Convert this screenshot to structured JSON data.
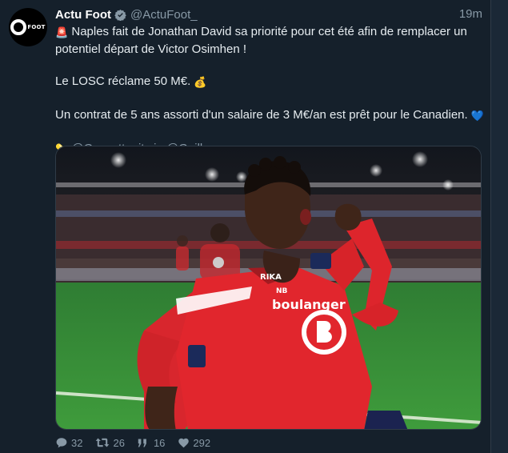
{
  "tweet": {
    "display_name": "Actu Foot",
    "handle": "@ActuFoot_",
    "time": "19m",
    "avatar_text": "FOOT",
    "lines": [
      "Naples fait de Jonathan David sa priorité pour cet été afin de remplacer un",
      "potentiel départ de Victor Osimhen !",
      "Le LOSC réclame 50 M€.",
      "Un contrat de 5 ans assorti d'un salaire de 3 M€/an est prêt pour le Canadien."
    ],
    "emojis": {
      "siren": "🚨",
      "money_bag": "💰",
      "blue_heart": "💙",
      "pill": "💊"
    },
    "source": {
      "mention": "@Gazzetta_it",
      "via": "via",
      "credit": "@Guillaumemp"
    },
    "photo": {
      "jersey_sponsor": "boulanger",
      "sleeve_sponsor": "RIKA",
      "chest_logo": "NB"
    },
    "stats": {
      "replies": "32",
      "retweets": "26",
      "quotes": "16",
      "likes": "292"
    }
  },
  "icons": [
    "verified-badge-icon",
    "siren-icon",
    "money-bag-icon",
    "blue-heart-icon",
    "pill-icon",
    "reply-icon",
    "retweet-icon",
    "quote-icon",
    "like-icon"
  ],
  "colors": {
    "background": "#15202b",
    "secondary_text": "#8899a6",
    "verified": "#8899a6",
    "heart": "#1d9bf0",
    "jersey": "#e1262d"
  }
}
